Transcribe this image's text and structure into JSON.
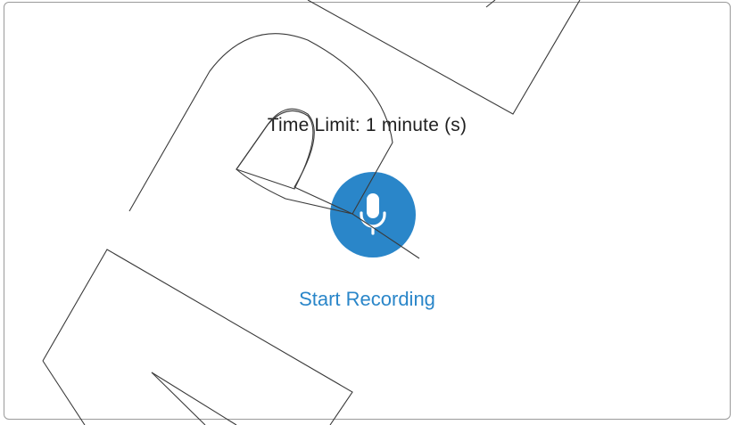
{
  "recorder": {
    "time_limit_text": "Time Limit: 1 minute (s)",
    "start_label": "Start Recording",
    "mic_icon": "microphone-icon",
    "accent_color": "#2a86c9"
  }
}
